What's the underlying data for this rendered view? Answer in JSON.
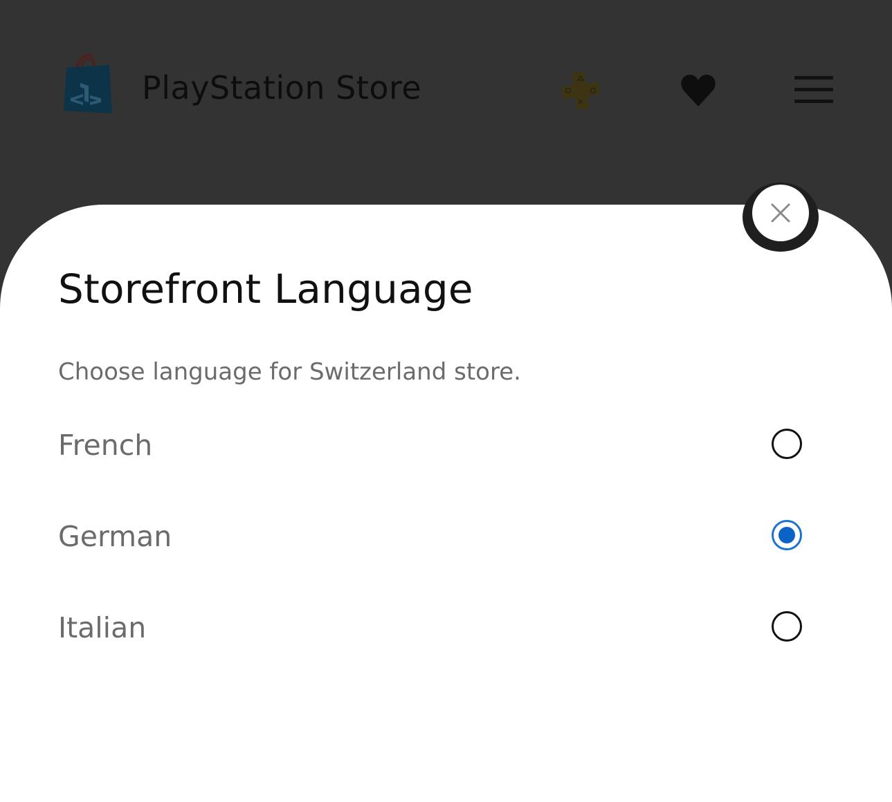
{
  "header": {
    "title": "PlayStation Store",
    "logo_icon": "playstation-store-bag-icon",
    "plus_icon": "playstation-plus-icon",
    "wishlist_icon": "heart-icon",
    "menu_icon": "hamburger-menu-icon"
  },
  "dialog": {
    "title": "Storefront Language",
    "subtitle": "Choose language for Switzerland store.",
    "close_icon": "close-icon",
    "options": [
      {
        "label": "French",
        "selected": false
      },
      {
        "label": "German",
        "selected": true
      },
      {
        "label": "Italian",
        "selected": false
      }
    ]
  },
  "colors": {
    "overlay_background": "#333333",
    "sheet_background": "#ffffff",
    "radio_selected": "#0b63c6",
    "text_muted": "#6b6b6b"
  }
}
